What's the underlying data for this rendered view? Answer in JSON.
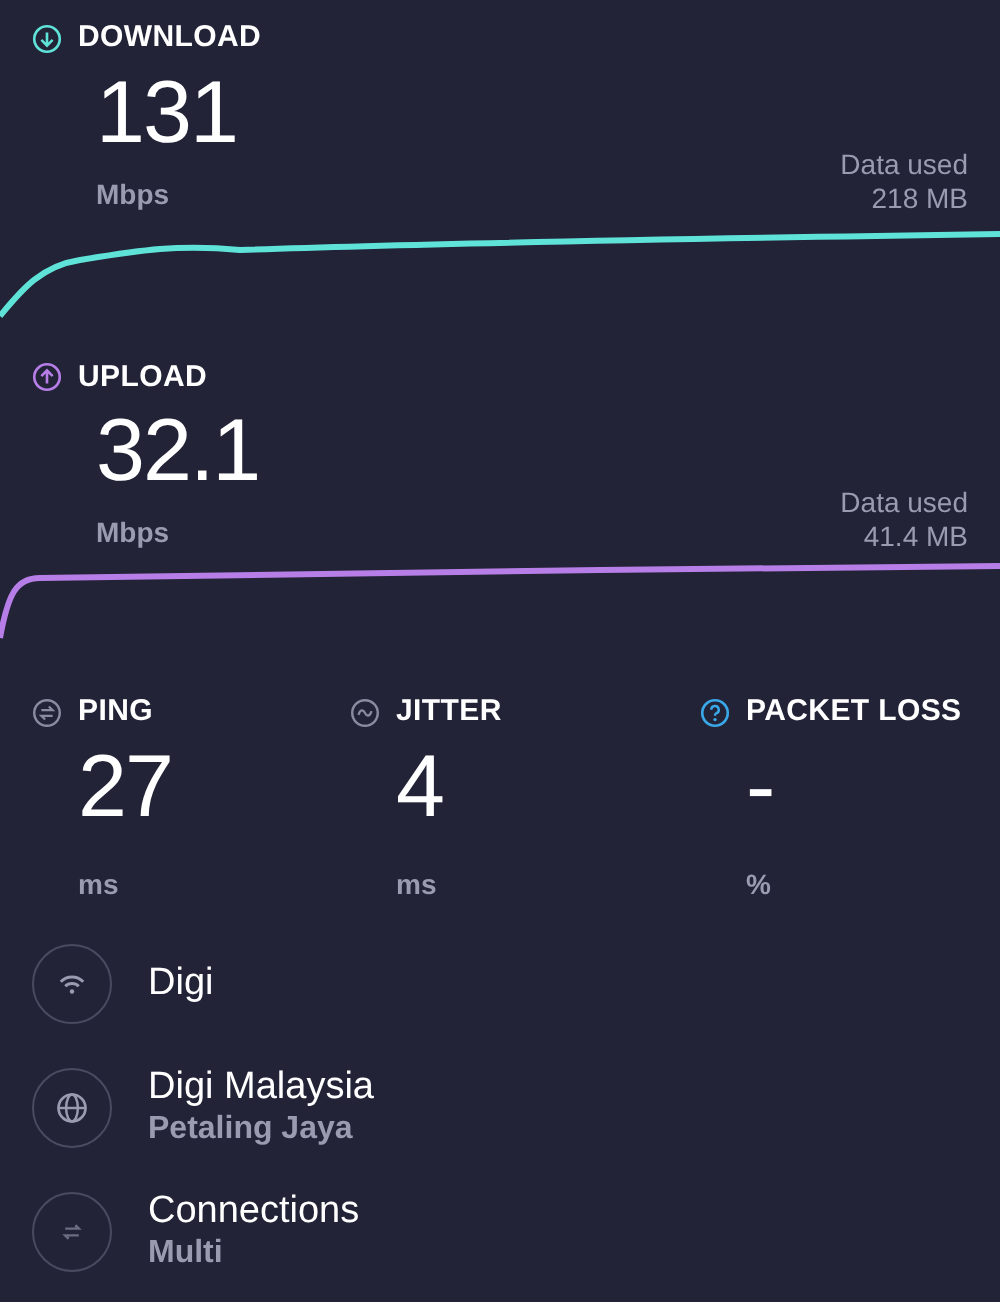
{
  "tests": [
    {
      "kind": "download",
      "label": "DOWNLOAD",
      "value": "131",
      "unit": "Mbps",
      "data_used_label": "Data used",
      "data_used": "218 MB",
      "color": "#5fe3d9"
    },
    {
      "kind": "upload",
      "label": "UPLOAD",
      "value": "32.1",
      "unit": "Mbps",
      "data_used_label": "Data used",
      "data_used": "41.4 MB",
      "color": "#b77ee8"
    }
  ],
  "metrics": [
    {
      "kind": "ping",
      "label": "PING",
      "value": "27",
      "unit": "ms"
    },
    {
      "kind": "jitter",
      "label": "JITTER",
      "value": "4",
      "unit": "ms"
    },
    {
      "kind": "packet_loss",
      "label": "PACKET LOSS",
      "value": "-",
      "unit": "%"
    }
  ],
  "info": [
    {
      "kind": "wifi",
      "title": "Digi"
    },
    {
      "kind": "globe",
      "title": "Digi Malaysia",
      "subtitle": "Petaling Jaya"
    },
    {
      "kind": "connections",
      "title": "Connections",
      "subtitle": "Multi"
    }
  ]
}
